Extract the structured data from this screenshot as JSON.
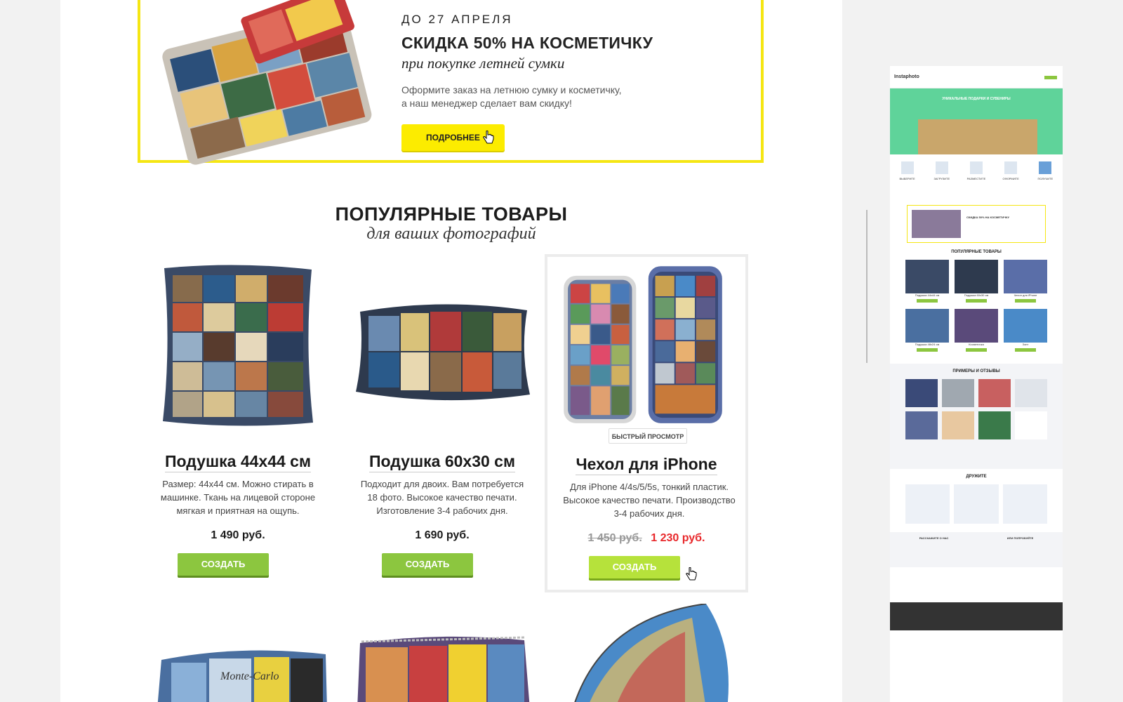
{
  "promo": {
    "date": "ДО 27 АПРЕЛЯ",
    "title": "СКИДКА 50% НА КОСМЕТИЧКУ",
    "subtitle": "при покупке летней сумки",
    "description_line1": "Оформите заказ на летнюю сумку и косметичку,",
    "description_line2": "а наш менеджер сделает вам скидку!",
    "button_label": "ПОДРОБНЕЕ",
    "accent_color": "#f5e613"
  },
  "popular": {
    "title": "ПОПУЛЯРНЫЕ ТОВАРЫ",
    "subtitle": "для ваших фотографий"
  },
  "products": [
    {
      "name": "Подушка 44х44 см",
      "description": "Размер: 44х44 см. Можно стирать в машинке. Ткань на лицевой стороне мягкая и приятная на ощупь.",
      "price": "1 490 руб.",
      "button_label": "СОЗДАТЬ"
    },
    {
      "name": "Подушка 60х30 см",
      "description": "Подходит для двоих. Вам потребуется 18 фото. Высокое качество печати. Изготовление 3-4 рабочих дня.",
      "price": "1 690 руб.",
      "button_label": "СОЗДАТЬ"
    },
    {
      "name": "Чехол для iPhone",
      "description": "Для iPhone 4/4s/5/5s, тонкий пластик. Высокое качество печати. Производство 3-4 рабочих дня.",
      "old_price": "1 450 руб.",
      "price": "1 230 руб.",
      "button_label": "СОЗДАТЬ",
      "quick_view_label": "БЫСТРЫЙ ПРОСМОТР"
    }
  ],
  "bottom_items": [
    {
      "image_text": "Monte-Carlo"
    },
    {
      "image_text": ""
    },
    {
      "image_text": ""
    }
  ],
  "preview": {
    "logo": "Instaphoto",
    "hero_title": "УНИКАЛЬНЫЕ ПОДАРКИ И СУВЕНИРЫ",
    "steps": [
      "ВЫБЕРИТЕ",
      "ЗАГРУЗИТЕ",
      "РАЗМЕСТИТЕ",
      "ОФОРМИТЕ",
      "ПОЛУЧИТЕ"
    ],
    "promo_title": "СКИДКА 50% НА КОСМЕТИЧКУ",
    "popular_title": "ПОПУЛЯРНЫЕ ТОВАРЫ",
    "grid_items": [
      "Подушка 44х44 см",
      "Подушка 60х30 см",
      "Чехол для iPhone",
      "Подушка 48х24 см",
      "Косметичка",
      "Зонт"
    ],
    "reviews_title": "ПРИМЕРЫ И ОТЗЫВЫ",
    "friends_title": "ДРУЖИТЕ",
    "share_title": "РАССКАЖИТЕ О НАС",
    "try_title": "ИЛИ ПОПРОБУЙТЕ"
  },
  "colors": {
    "green_button": "#8cc63f",
    "green_button_hover": "#b6e23b",
    "sale_red": "#e8282b",
    "hero_green": "#5fd39a"
  }
}
